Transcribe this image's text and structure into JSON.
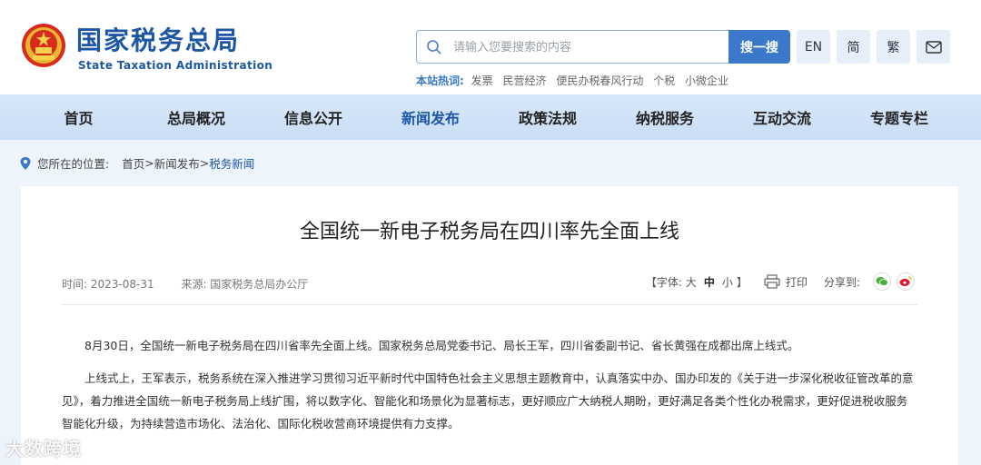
{
  "brand": {
    "name_cn": "国家税务总局",
    "name_en": "State Taxation Administration"
  },
  "search": {
    "placeholder": "请输入您要搜索的内容",
    "button_label": "搜一搜"
  },
  "tools": {
    "en": "EN",
    "simplified": "简",
    "traditional": "繁",
    "mail_icon": "mail-icon"
  },
  "hot": {
    "label": "本站热词:",
    "items": [
      "发票",
      "民营经济",
      "便民办税春风行动",
      "个税",
      "小微企业"
    ]
  },
  "nav": {
    "items": [
      {
        "label": "首页"
      },
      {
        "label": "总局概况"
      },
      {
        "label": "信息公开"
      },
      {
        "label": "新闻发布"
      },
      {
        "label": "政策法规"
      },
      {
        "label": "纳税服务"
      },
      {
        "label": "互动交流"
      },
      {
        "label": "专题专栏"
      }
    ],
    "active_index": 3
  },
  "breadcrumb": {
    "prefix": "您所在的位置:",
    "path": [
      "首页",
      "新闻发布",
      "税务新闻"
    ],
    "separator": ">"
  },
  "article": {
    "title": "全国统一新电子税务局在四川率先全面上线",
    "time": "时间: 2023-08-31",
    "source": "来源: 国家税务总局办公厅",
    "font_label_open": "【字体:",
    "font_large": "大",
    "font_medium": "中",
    "font_small": "小",
    "font_label_close": "】",
    "print": "打印",
    "share": "分享到:",
    "paragraphs": [
      "8月30日，全国统一新电子税务局在四川省率先全面上线。国家税务总局党委书记、局长王军，四川省委副书记、省长黄强在成都出席上线式。",
      "上线式上，王军表示，税务系统在深入推进学习贯彻习近平新时代中国特色社会主义思想主题教育中，认真落实中办、国办印发的《关于进一步深化税收征管改革的意见》，着力推进全国统一新电子税务局上线扩围，将以数字化、智能化和场景化为显著标志，更好顺应广大纳税人期盼，更好满足各类个性化办税需求，更好促进税收服务智能化升级，为持续营造市场化、法治化、国际化税收营商环境提供有力支撑。"
    ]
  },
  "watermark": "大数跨境",
  "colors": {
    "brand_blue": "#1c56a5",
    "button_blue": "#3b78c9",
    "nav_bg": "#d2e3f7",
    "page_bg": "#eef4fb"
  }
}
